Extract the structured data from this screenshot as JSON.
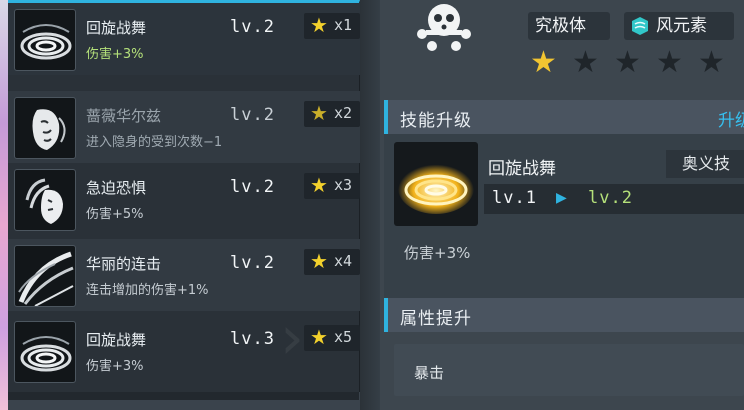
{
  "skills": [
    {
      "name": "回旋战舞",
      "desc": "伤害+3%",
      "level": "lv.2",
      "star_mult": "x1",
      "desc_color": "green"
    },
    {
      "name": "蔷薇华尔兹",
      "desc": "进入隐身的受到次数−1",
      "level": "lv.2",
      "star_mult": "x2",
      "desc_color": "normal"
    },
    {
      "name": "急迫恐惧",
      "desc": "伤害+5%",
      "level": "lv.2",
      "star_mult": "x3",
      "desc_color": "normal"
    },
    {
      "name": "华丽的连击",
      "desc": "连击增加的伤害+1%",
      "level": "lv.2",
      "star_mult": "x4",
      "desc_color": "normal"
    },
    {
      "name": "回旋战舞",
      "desc": "伤害+3%",
      "level": "lv.3",
      "star_mult": "x5",
      "desc_color": "normal"
    }
  ],
  "character": {
    "form_tag": "究极体",
    "element_tag": "风元素",
    "stars_filled": 1,
    "stars_total": 5
  },
  "skill_upgrade": {
    "section_title": "技能升级",
    "right_link": "升级",
    "skill_name": "回旋战舞",
    "skill_type": "奥义技",
    "level_from": "lv.1",
    "level_to": "lv.2",
    "effect": "伤害+3%"
  },
  "attribute_section": {
    "title": "属性提升",
    "rows": [
      {
        "label": "暴击"
      }
    ]
  },
  "colors": {
    "accent": "#2fb3e0",
    "star": "#f3d12c",
    "green_text": "#b4e07a",
    "panel": "#2a3138"
  },
  "icons": {
    "skill_icons": [
      "swirl-skill-icon",
      "rose-mask-skill-icon",
      "fear-mask-skill-icon",
      "combo-slash-skill-icon",
      "swirl-skill-icon"
    ],
    "character_icon": "skull-emblem-icon",
    "element_icon": "wind-element-icon",
    "star_icon": "star-icon"
  }
}
